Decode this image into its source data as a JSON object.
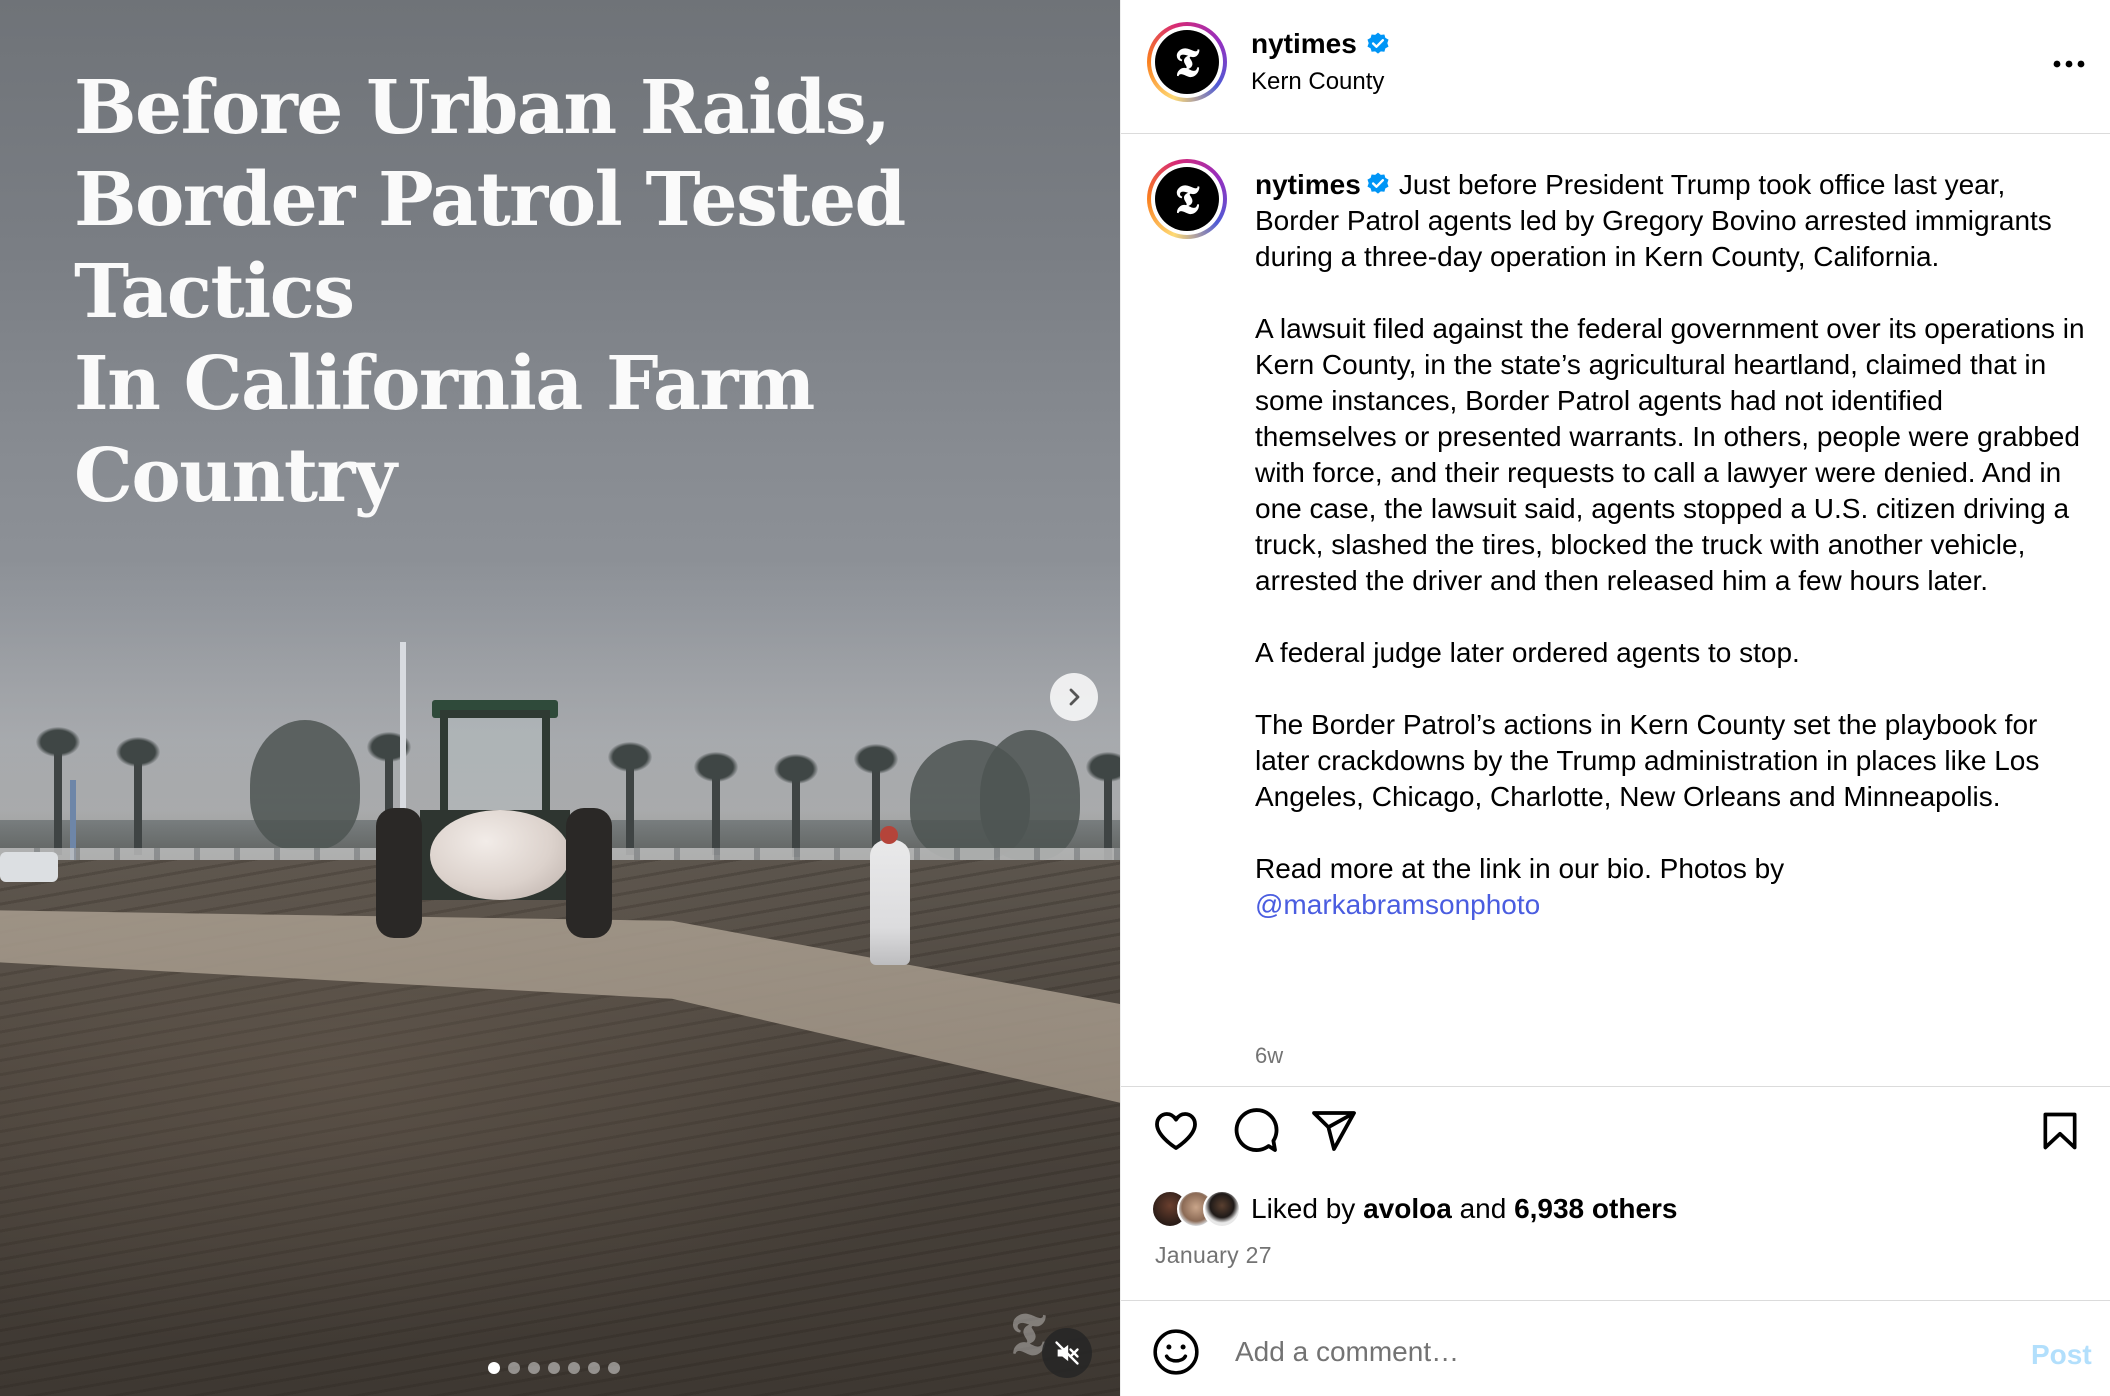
{
  "media": {
    "headline": "Before Urban Raids,\nBorder Patrol Tested Tactics\nIn California Farm Country",
    "watermark": "𝕿",
    "carousel_total": 7,
    "carousel_active": 1
  },
  "header": {
    "username": "nytimes",
    "location": "Kern County",
    "avatar_glyph": "𝕿"
  },
  "caption": {
    "username": "nytimes",
    "paragraphs": [
      "Just before President Trump took office last year, Border Patrol agents led by Gregory Bovino arrested immigrants during a three-day operation in Kern County, California.",
      "A lawsuit filed against the federal government over its operations in Kern County, in the state’s agricultural heartland, claimed that in some instances, Border Patrol agents had not identified themselves or presented warrants. In others, people were grabbed with force, and their requests to call a lawyer were denied. And in one case, the lawsuit said, agents stopped a U.S. citizen driving a truck, slashed the tires, blocked the truck with another vehicle, arrested the driver and then released him a few hours later.",
      "A federal judge later ordered agents to stop.",
      "The Border Patrol’s actions in Kern County set the playbook for later crackdowns by the Trump administration in places like Los Angeles, Chicago, Charlotte, New Orleans and Minneapolis.",
      "Read more at the link in our bio. Photos by"
    ],
    "mention": "@markabramsonphoto",
    "time_ago": "6w"
  },
  "likes": {
    "prefix": "Liked by",
    "liked_by_user": "avoloa",
    "joiner": "and",
    "others": "6,938 others"
  },
  "post_date": "January 27",
  "comment": {
    "placeholder": "Add a comment…",
    "post_label": "Post"
  },
  "colors": {
    "verified": "#0095f6",
    "mention": "#4a5de0",
    "post_disabled": "#b2dffc",
    "secondary_text": "#737373"
  }
}
